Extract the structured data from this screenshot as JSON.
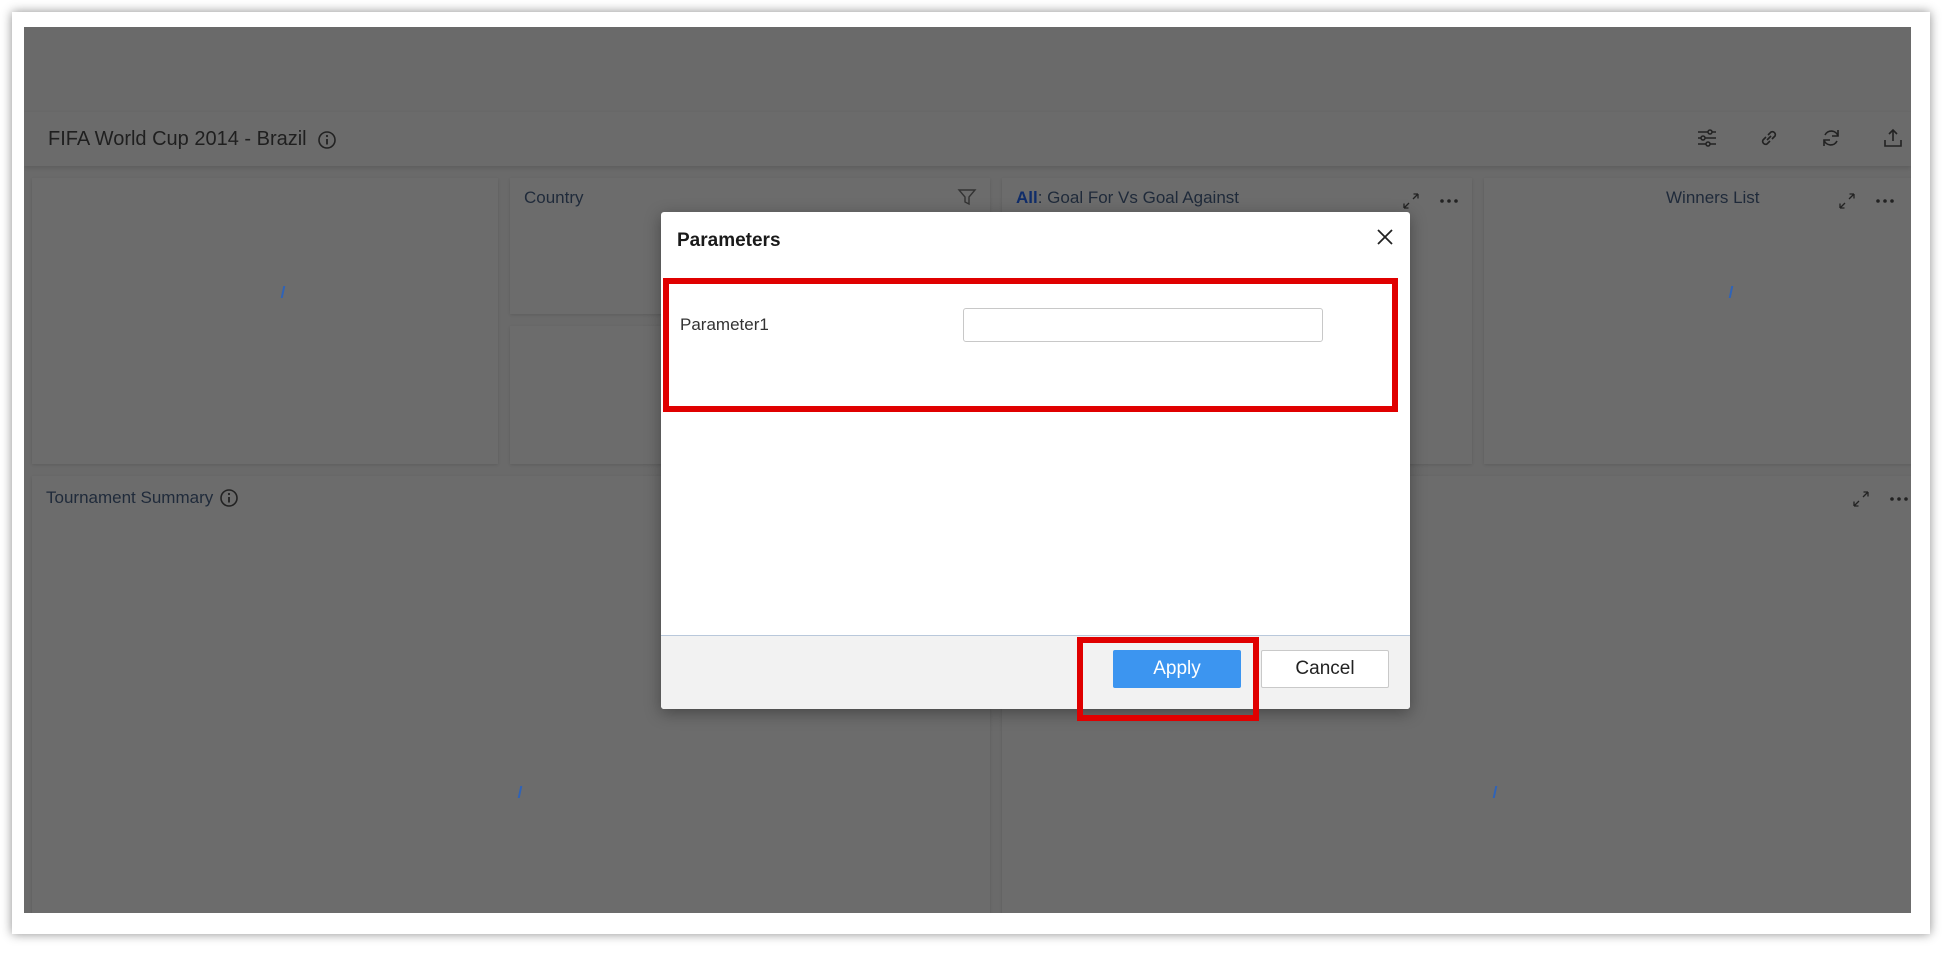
{
  "dashboard": {
    "title": "FIFA World Cup 2014 - Brazil",
    "tools": [
      "filter-settings-icon",
      "link-icon",
      "refresh-icon",
      "export-icon"
    ]
  },
  "widgets": {
    "country": {
      "title": "Country"
    },
    "goal_chart": {
      "filter_label": "All",
      "title": ": Goal For Vs  Goal Against"
    },
    "winners": {
      "title": "Winners List"
    },
    "tournament": {
      "title": "Tournament Summary"
    }
  },
  "dialog": {
    "title": "Parameters",
    "parameter_label": "Parameter1",
    "parameter_value": "",
    "apply_label": "Apply",
    "cancel_label": "Cancel"
  },
  "colors": {
    "overlay": "#6a6a6a",
    "primary_button": "#3c95f0",
    "highlight": "#e00000"
  }
}
